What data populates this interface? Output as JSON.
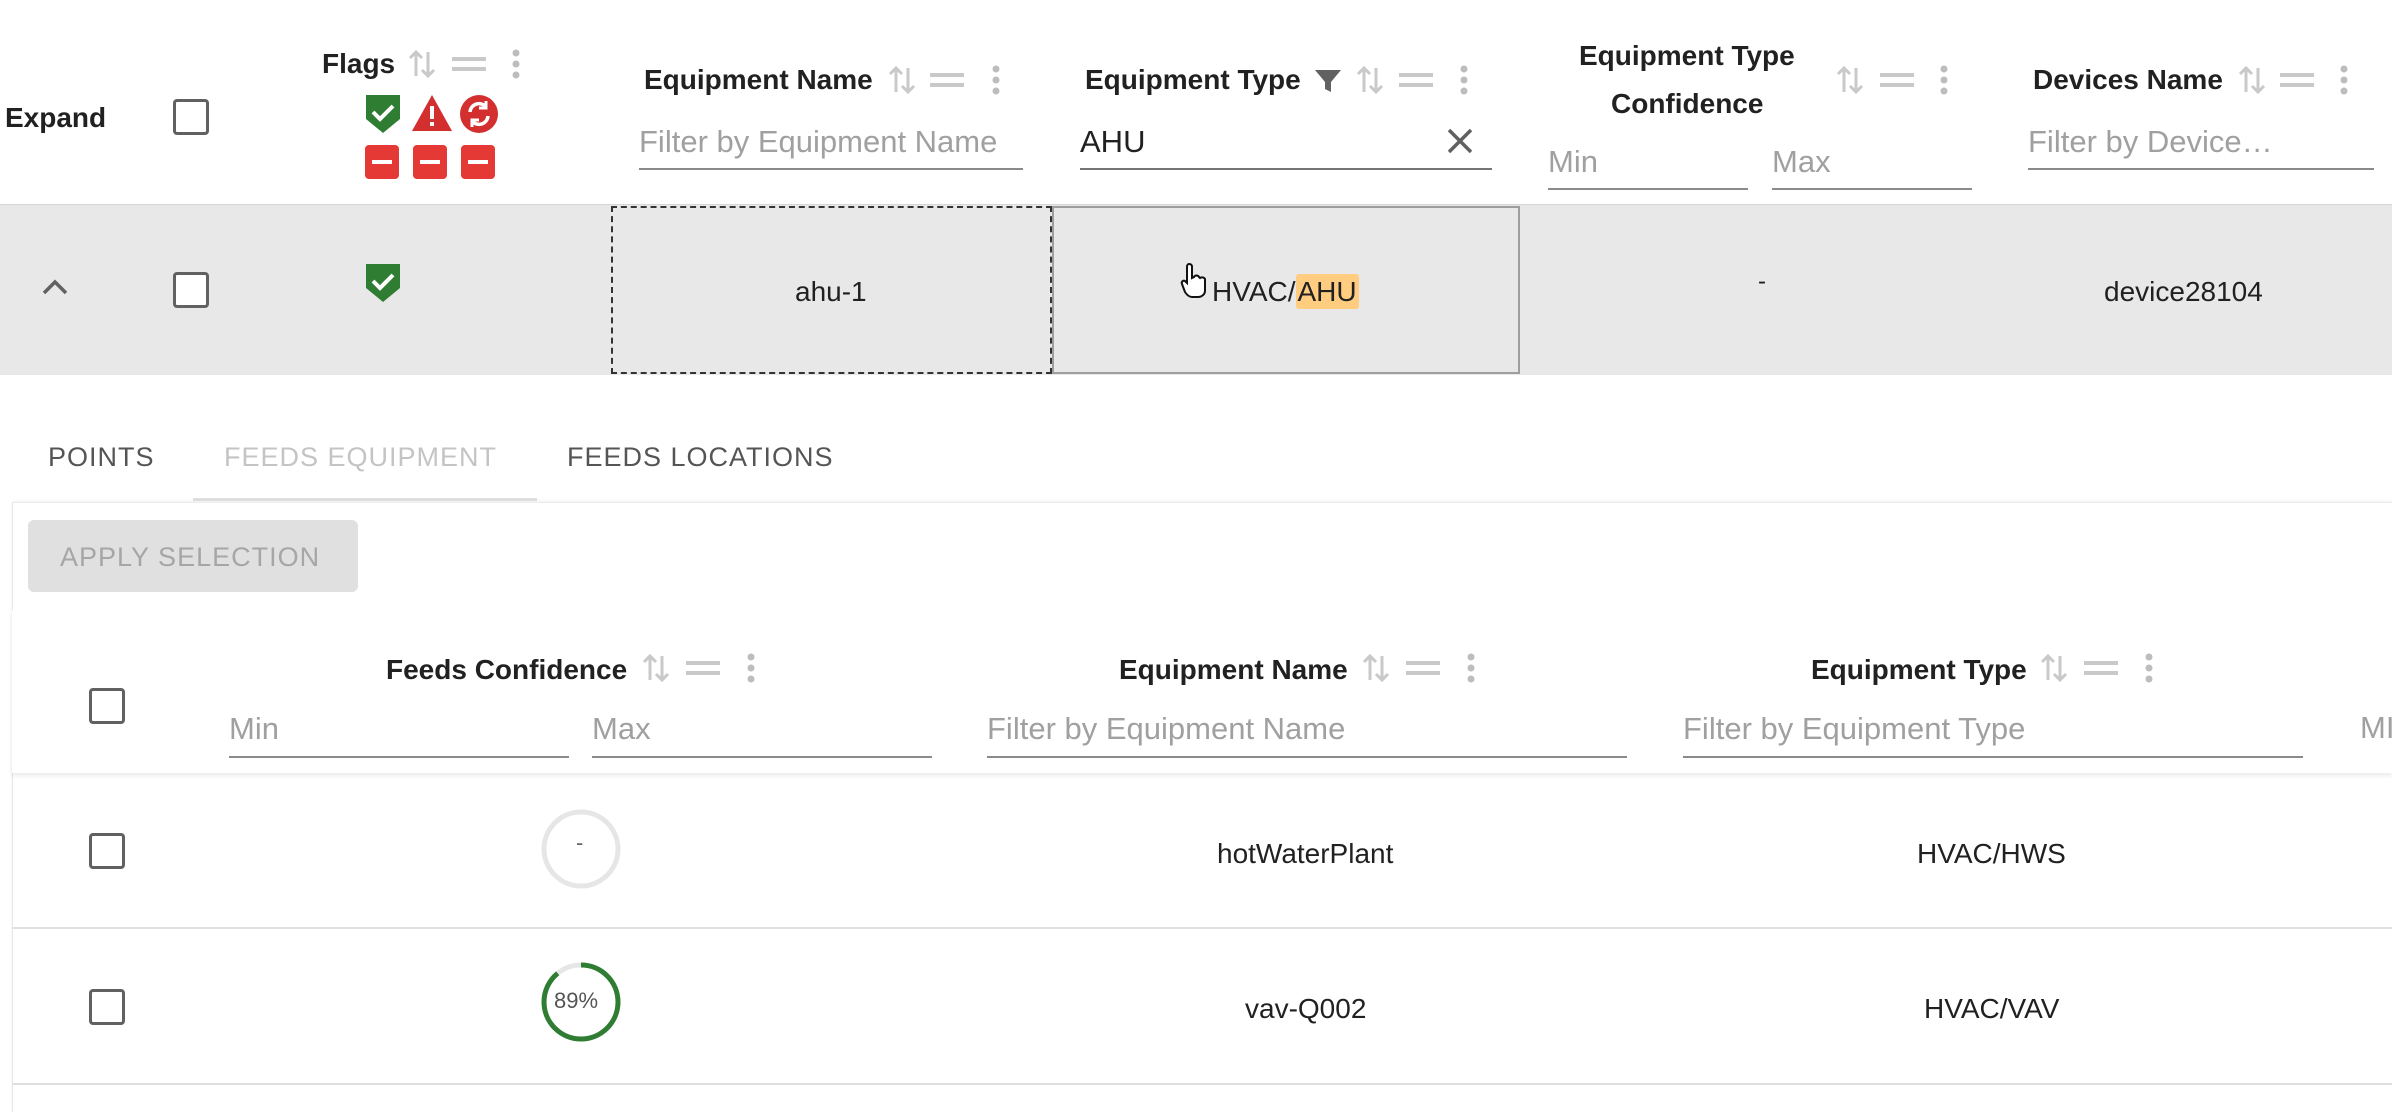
{
  "header": {
    "expand_label": "Expand",
    "flags_label": "Flags",
    "equipment_name_label": "Equipment Name",
    "equipment_name_placeholder": "Filter by Equipment Name",
    "equipment_type_label": "Equipment Type",
    "equipment_type_value": "AHU",
    "confidence_label_line1": "Equipment Type",
    "confidence_label_line2": "Confidence",
    "min_placeholder": "Min",
    "max_placeholder": "Max",
    "devices_name_label": "Devices Name",
    "devices_name_placeholder": "Filter by Device…"
  },
  "row": {
    "equipment_name": "ahu-1",
    "equipment_type_prefix": "HVAC/",
    "equipment_type_highlight": "AHU",
    "confidence": "-",
    "device_name": "device28104"
  },
  "tabs": [
    {
      "label": "POINTS"
    },
    {
      "label": "FEEDS EQUIPMENT"
    },
    {
      "label": "FEEDS LOCATIONS"
    }
  ],
  "sub": {
    "apply_label": "APPLY SELECTION",
    "feeds_confidence_label": "Feeds Confidence",
    "equipment_name_label": "Equipment Name",
    "equipment_type_label": "Equipment Type",
    "min_placeholder": "Min",
    "max_placeholder": "Max",
    "equipment_name_placeholder": "Filter by Equipment Name",
    "equipment_type_placeholder": "Filter by Equipment Type",
    "overflow_placeholder": "MI",
    "rows": [
      {
        "confidence_text": "-",
        "confidence_value": 0,
        "equipment_name": "hotWaterPlant",
        "equipment_type": "HVAC/HWS"
      },
      {
        "confidence_text": "89%",
        "confidence_value": 89,
        "equipment_name": "vav-Q002",
        "equipment_type": "HVAC/VAV"
      }
    ]
  },
  "colors": {
    "success_green": "#2e7d32",
    "warning_red": "#d32f2f",
    "highlight_orange": "#ffcc80",
    "selected_row_bg": "#e8e8e8"
  }
}
